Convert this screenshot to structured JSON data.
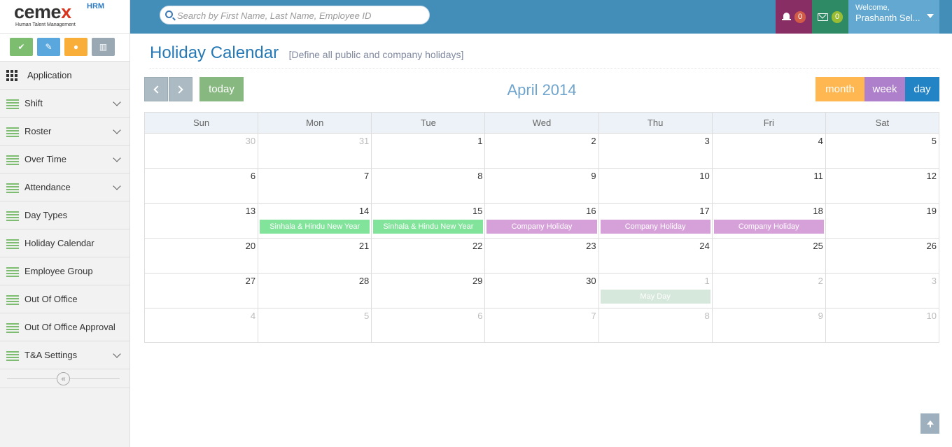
{
  "logo": {
    "brand": "cemex",
    "product": "HRM",
    "tagline": "Human Talent Management"
  },
  "quick_actions": [
    {
      "icon": "check-icon",
      "color": "#7cbd6f"
    },
    {
      "icon": "edit-icon",
      "color": "#5aa7de"
    },
    {
      "icon": "user-icon",
      "color": "#f9ae3a"
    },
    {
      "icon": "chart-icon",
      "color": "#9aa8b3"
    }
  ],
  "sidebar": {
    "items": [
      {
        "label": "Application",
        "icon": "grid-icon",
        "has_submenu": false
      },
      {
        "label": "Shift",
        "icon": "list-icon",
        "has_submenu": true
      },
      {
        "label": "Roster",
        "icon": "list-icon",
        "has_submenu": true
      },
      {
        "label": "Over Time",
        "icon": "list-icon",
        "has_submenu": true
      },
      {
        "label": "Attendance",
        "icon": "list-icon",
        "has_submenu": true
      },
      {
        "label": "Day Types",
        "icon": "list-icon",
        "has_submenu": false
      },
      {
        "label": "Holiday Calendar",
        "icon": "list-icon",
        "has_submenu": false
      },
      {
        "label": "Employee Group",
        "icon": "list-icon",
        "has_submenu": false
      },
      {
        "label": "Out Of Office",
        "icon": "list-icon",
        "has_submenu": false
      },
      {
        "label": "Out Of Office Approval",
        "icon": "list-icon",
        "has_submenu": false
      },
      {
        "label": "T&A Settings",
        "icon": "list-icon",
        "has_submenu": true
      }
    ]
  },
  "topbar": {
    "search_placeholder": "Search by First Name, Last Name, Employee ID",
    "notifications_count": "0",
    "messages_count": "0",
    "welcome": "Welcome,",
    "user_name": "Prashanth Sel...",
    "colors": {
      "bar": "#438eb9",
      "notifications": "#892e65",
      "messages": "#2e8965",
      "user": "#62a8d1"
    }
  },
  "page": {
    "title": "Holiday Calendar",
    "subtitle": "[Define all public and company holidays]"
  },
  "calendar": {
    "title": "April 2014",
    "today_label": "today",
    "views": {
      "month": "month",
      "week": "week",
      "day": "day"
    },
    "weekdays": [
      "Sun",
      "Mon",
      "Tue",
      "Wed",
      "Thu",
      "Fri",
      "Sat"
    ],
    "weeks": [
      [
        {
          "day": "30",
          "other": true
        },
        {
          "day": "31",
          "other": true
        },
        {
          "day": "1"
        },
        {
          "day": "2"
        },
        {
          "day": "3"
        },
        {
          "day": "4"
        },
        {
          "day": "5"
        }
      ],
      [
        {
          "day": "6"
        },
        {
          "day": "7"
        },
        {
          "day": "8"
        },
        {
          "day": "9"
        },
        {
          "day": "10"
        },
        {
          "day": "11"
        },
        {
          "day": "12"
        }
      ],
      [
        {
          "day": "13"
        },
        {
          "day": "14",
          "event": "Sinhala & Hindu New Year",
          "event_type": "green"
        },
        {
          "day": "15",
          "event": "Sinhala & Hindu New Year",
          "event_type": "green"
        },
        {
          "day": "16",
          "event": "Company Holiday",
          "event_type": "pink"
        },
        {
          "day": "17",
          "event": "Company Holiday",
          "event_type": "pink"
        },
        {
          "day": "18",
          "event": "Company Holiday",
          "event_type": "pink"
        },
        {
          "day": "19"
        }
      ],
      [
        {
          "day": "20"
        },
        {
          "day": "21"
        },
        {
          "day": "22"
        },
        {
          "day": "23"
        },
        {
          "day": "24"
        },
        {
          "day": "25"
        },
        {
          "day": "26"
        }
      ],
      [
        {
          "day": "27"
        },
        {
          "day": "28"
        },
        {
          "day": "29"
        },
        {
          "day": "30"
        },
        {
          "day": "1",
          "other": true,
          "event": "May Day",
          "event_type": "faded"
        },
        {
          "day": "2",
          "other": true
        },
        {
          "day": "3",
          "other": true
        }
      ],
      [
        {
          "day": "4",
          "other": true
        },
        {
          "day": "5",
          "other": true
        },
        {
          "day": "6",
          "other": true
        },
        {
          "day": "7",
          "other": true
        },
        {
          "day": "8",
          "other": true
        },
        {
          "day": "9",
          "other": true
        },
        {
          "day": "10",
          "other": true
        }
      ]
    ],
    "event_colors": {
      "green": "#82e39b",
      "pink": "#d6a1d9",
      "faded": "#d6e7dc"
    }
  }
}
